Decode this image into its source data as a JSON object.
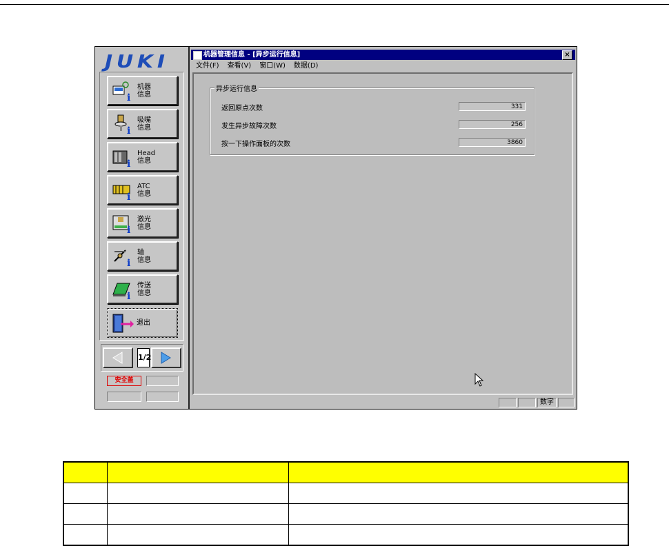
{
  "logo": {
    "text": "JUKI"
  },
  "nav": {
    "items": [
      {
        "label": "机器\n信息",
        "icon": "machine-info-icon"
      },
      {
        "label": "吸嘴\n信息",
        "icon": "nozzle-info-icon"
      },
      {
        "label": "Head\n信息",
        "icon": "head-info-icon"
      },
      {
        "label": "ATC\n信息",
        "icon": "atc-info-icon"
      },
      {
        "label": "激光\n信息",
        "icon": "laser-info-icon"
      },
      {
        "label": "轴\n信息",
        "icon": "axis-info-icon"
      },
      {
        "label": "传送\n信息",
        "icon": "conveyor-info-icon"
      },
      {
        "label": "退出",
        "icon": "exit-door-icon"
      }
    ]
  },
  "pager": {
    "page": "1/2",
    "prev_icon": "left-arrow-icon",
    "next_icon": "right-arrow-icon"
  },
  "status": {
    "safety_cover": "安全盖"
  },
  "window": {
    "title": "机器管理信息 - [异步运行信息]",
    "close_label": "×",
    "menu": [
      "文件(F)",
      "查看(V)",
      "窗口(W)",
      "数据(D)"
    ],
    "group_title": "异步运行信息",
    "rows": [
      {
        "label": "返回原点次数",
        "value": "331"
      },
      {
        "label": "发生异步故障次数",
        "value": "256"
      },
      {
        "label": "按一下操作面板的次数",
        "value": "3860"
      }
    ],
    "statusbar_text": "数字"
  },
  "colors": {
    "title_bar": "#000080",
    "logo": "#1e4db8",
    "table_header": "#ffff00",
    "safety": "#e00000"
  },
  "table": {
    "rows": 4,
    "cols": 3
  }
}
